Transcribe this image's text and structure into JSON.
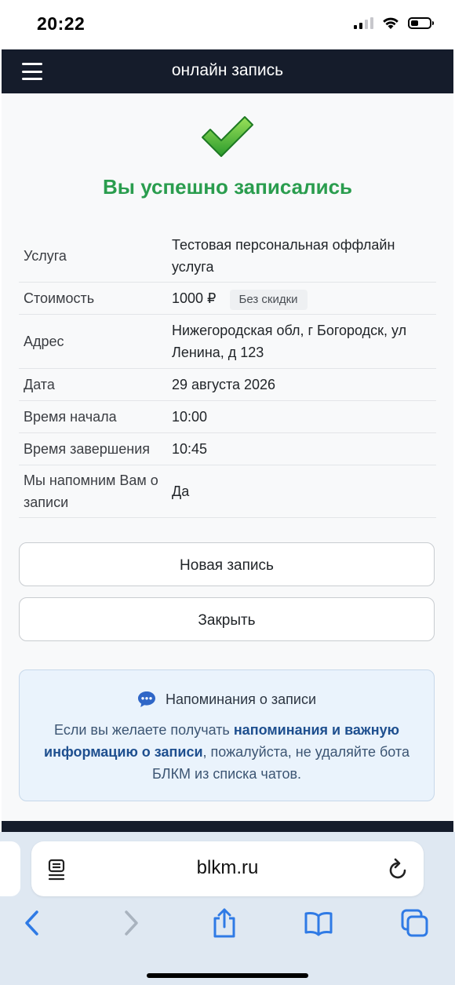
{
  "status_bar": {
    "time": "20:22"
  },
  "navbar": {
    "title": "онлайн запись"
  },
  "success": {
    "title": "Вы успешно записались"
  },
  "details": {
    "service_label": "Услуга",
    "service_value": "Тестовая персональная оффлайн услуга",
    "price_label": "Стоимость",
    "price_value": "1000 ₽",
    "discount_badge": "Без скидки",
    "address_label": "Адрес",
    "address_value": "Нижегородская обл, г Богородск, ул Ленина, д 123",
    "date_label": "Дата",
    "date_value": "29 августа 2026",
    "start_label": "Время начала",
    "start_value": "10:00",
    "end_label": "Время завершения",
    "end_value": "10:45",
    "remind_label": "Мы напомним Вам о записи",
    "remind_value": "Да"
  },
  "buttons": {
    "new_booking": "Новая запись",
    "close": "Закрыть"
  },
  "reminder_box": {
    "title": "Напоминания о записи",
    "text_before": "Если вы желаете получать ",
    "text_bold": "напоминания и важную информацию о записи",
    "text_after": ", пожалуйста, не удаляйте бота БЛКМ из списка чатов."
  },
  "browser": {
    "url": "blkm.ru"
  },
  "colors": {
    "success_green": "#2a9d4e",
    "navbar_bg": "#151c2b",
    "info_bg": "#eaf3fc",
    "ios_blue": "#2f7ae5"
  },
  "icons": {
    "menu": "hamburger-icon",
    "success": "checkmark-icon",
    "chat": "chat-bubble-icon",
    "reader": "reader-icon",
    "reload": "reload-icon",
    "back": "chevron-left-icon",
    "forward": "chevron-right-icon",
    "share": "share-icon",
    "bookmarks": "book-icon",
    "tabs": "tabs-icon"
  }
}
